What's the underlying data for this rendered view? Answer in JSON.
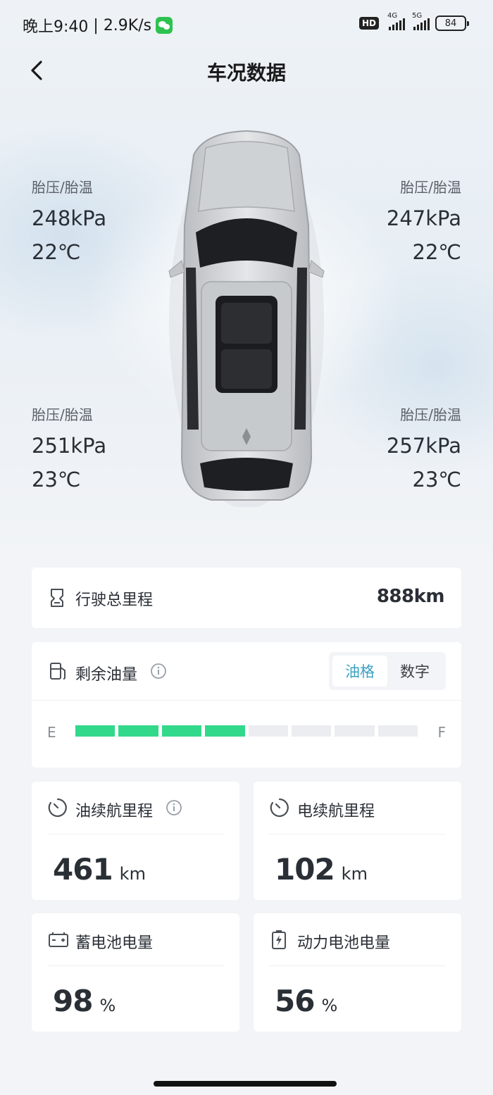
{
  "status_bar": {
    "time": "晚上9:40",
    "net_speed": "2.9K/s",
    "hd": "HD",
    "net1": "4G",
    "net2": "5G",
    "battery": "84"
  },
  "header": {
    "title": "车况数据"
  },
  "tires": {
    "front_left": {
      "label": "胎压/胎温",
      "pressure": "248kPa",
      "temp": "22℃"
    },
    "front_right": {
      "label": "胎压/胎温",
      "pressure": "247kPa",
      "temp": "22℃"
    },
    "rear_left": {
      "label": "胎压/胎温",
      "pressure": "251kPa",
      "temp": "23℃"
    },
    "rear_right": {
      "label": "胎压/胎温",
      "pressure": "257kPa",
      "temp": "23℃"
    }
  },
  "mileage": {
    "label": "行驶总里程",
    "value": "888km"
  },
  "fuel": {
    "label": "剩余油量",
    "toggle": {
      "options": [
        "油格",
        "数字"
      ],
      "selected": "油格"
    },
    "empty_label": "E",
    "full_label": "F",
    "bars_total": 8,
    "bars_filled": 4,
    "fill_color": "#33d98b"
  },
  "oil_range": {
    "label": "油续航里程",
    "value": "461",
    "unit": "km"
  },
  "elec_range": {
    "label": "电续航里程",
    "value": "102",
    "unit": "km"
  },
  "battery_12v": {
    "label": "蓄电池电量",
    "value": "98",
    "unit": "%"
  },
  "power_battery": {
    "label": "动力电池电量",
    "value": "56",
    "unit": "%"
  },
  "colors": {
    "accent": "#3ba3c4",
    "bar_fill": "#33d98b",
    "bar_empty": "#ebedf0"
  }
}
